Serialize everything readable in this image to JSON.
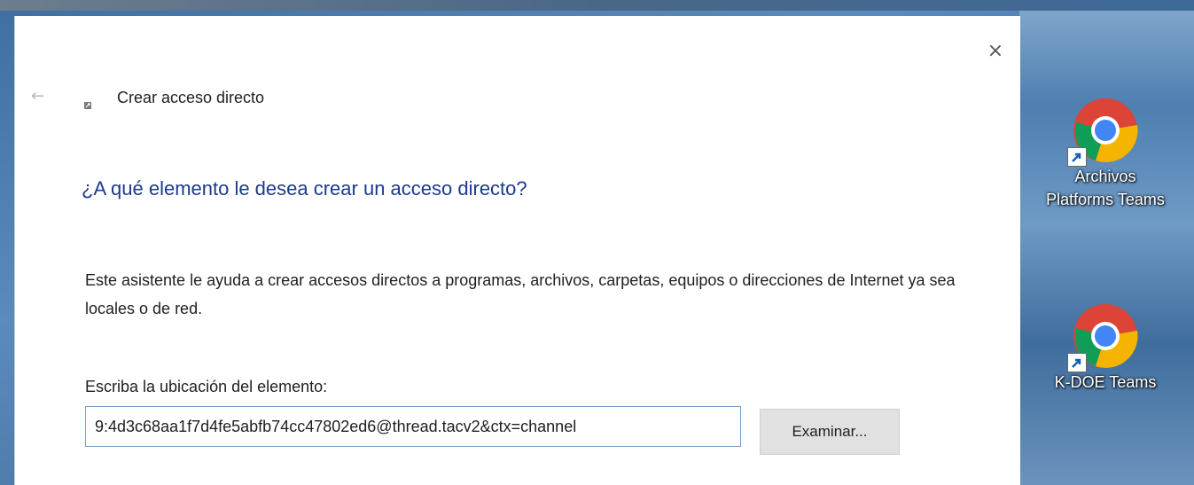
{
  "dialog": {
    "title": "Crear acceso directo",
    "question": "¿A qué elemento le desea crear un acceso directo?",
    "description": "Este asistente le ayuda a crear accesos directos a programas, archivos, carpetas, equipos o direcciones de Internet ya sea locales o de red.",
    "location_label": "Escriba la ubicación del elemento:",
    "location_value": "9:4d3c68aa1f7d4fe5abfb74cc47802ed6@thread.tacv2&ctx=channel",
    "browse_label": "Examinar...",
    "close_glyph": "×",
    "back_glyph": "←"
  },
  "desktop": {
    "icons": [
      {
        "label": "Archivos\nPlatforms Teams",
        "icon": "chrome-icon"
      },
      {
        "label": "K-DOE Teams",
        "icon": "chrome-icon"
      }
    ]
  },
  "colors": {
    "question": "#1c3a8f",
    "input_border": "#7a9cc4",
    "button_bg": "#e1e1e1"
  }
}
